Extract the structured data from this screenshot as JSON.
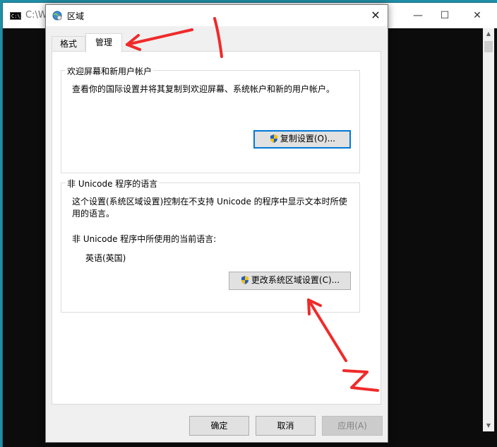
{
  "console": {
    "title": "C:\\Wi",
    "minimize": "—",
    "maximize": "☐",
    "close": "✕"
  },
  "dialog": {
    "title": "区域",
    "close": "✕",
    "tabs": [
      {
        "label": "格式"
      },
      {
        "label": "管理"
      }
    ],
    "group_welcome": {
      "label": "欢迎屏幕和新用户帐户",
      "description": "查看你的国际设置并将其复制到欢迎屏幕、系统帐户和新的用户帐户。",
      "copy_button": "复制设置(O)..."
    },
    "group_unicode": {
      "label": "非 Unicode 程序的语言",
      "description_line1": "这个设置(系统区域设置)控制在不支持 Unicode 的程序中显示文本时所使",
      "description_line2": "用的语言。",
      "current_label": "非 Unicode 程序中所使用的当前语言:",
      "current_value": "英语(英国)",
      "change_button": "更改系统区域设置(C)..."
    },
    "footer": {
      "ok": "确定",
      "cancel": "取消",
      "apply": "应用(A)"
    }
  },
  "annotations": {
    "mark1": "1",
    "mark2": "2",
    "color": "#f02a2a"
  }
}
